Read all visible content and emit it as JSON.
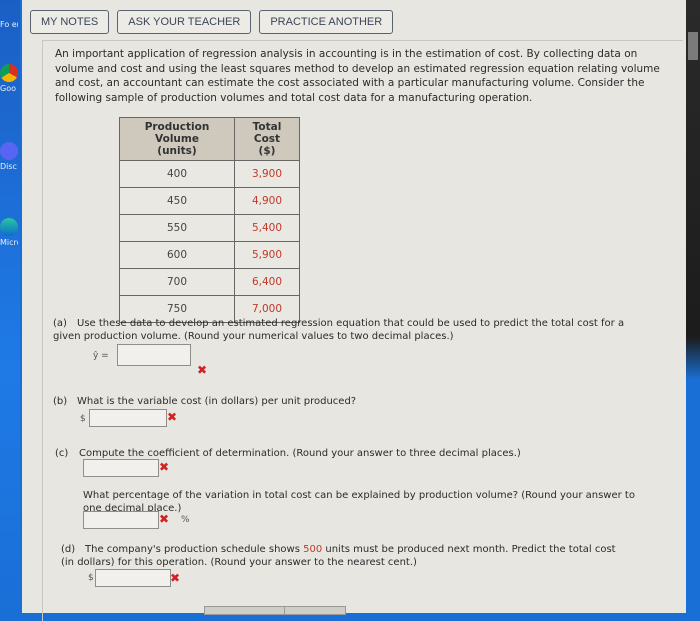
{
  "toolbar": {
    "my_notes": "MY NOTES",
    "ask_teacher": "ASK YOUR TEACHER",
    "practice_another": "PRACTICE ANOTHER"
  },
  "desktop_icons": [
    {
      "label": "Fo en",
      "icon": "folder-icon"
    },
    {
      "label": "Goo Chro",
      "icon": "chrome-icon"
    },
    {
      "label": "Disc",
      "icon": "discord-icon"
    },
    {
      "label": "Micro Edg",
      "icon": "edge-icon"
    }
  ],
  "intro": "An important application of regression analysis in accounting is in the estimation of cost. By collecting data on volume and cost and using the least squares method to develop an estimated regression equation relating volume and cost, an accountant can estimate the cost associated with a particular manufacturing volume. Consider the following sample of production volumes and total cost data for a manufacturing operation.",
  "table": {
    "headers": [
      "Production Volume",
      "(units)",
      "Total Cost",
      "($)"
    ],
    "rows": [
      {
        "volume": "400",
        "cost": "3,900"
      },
      {
        "volume": "450",
        "cost": "4,900"
      },
      {
        "volume": "550",
        "cost": "5,400"
      },
      {
        "volume": "600",
        "cost": "5,900"
      },
      {
        "volume": "700",
        "cost": "6,400"
      },
      {
        "volume": "750",
        "cost": "7,000"
      }
    ]
  },
  "questions": {
    "a": {
      "label": "(a)",
      "text": "Use these data to develop an estimated regression equation that could be used to predict the total cost for a given production volume. (Round your numerical values to two decimal places.)",
      "prefix": "ŷ =",
      "value": "",
      "status": "✖"
    },
    "b": {
      "label": "(b)",
      "text": "What is the variable cost (in dollars) per unit produced?",
      "prefix": "$",
      "value": "",
      "status": "✖"
    },
    "c": {
      "label": "(c)",
      "text": "Compute the coefficient of determination. (Round your answer to three decimal places.)",
      "value": "",
      "status": "✖",
      "followup_text": "What percentage of the variation in total cost can be explained by production volume? (Round your answer to one decimal place.)",
      "followup_value": "",
      "followup_status": "✖",
      "followup_suffix": "%"
    },
    "d": {
      "label": "(d)",
      "text_before": "The company's production schedule shows ",
      "highlight": "500",
      "text_after": " units must be produced next month. Predict the total cost (in dollars) for this operation. (Round your answer to the nearest cent.)",
      "prefix": "$",
      "value": "",
      "status": "✖"
    }
  }
}
